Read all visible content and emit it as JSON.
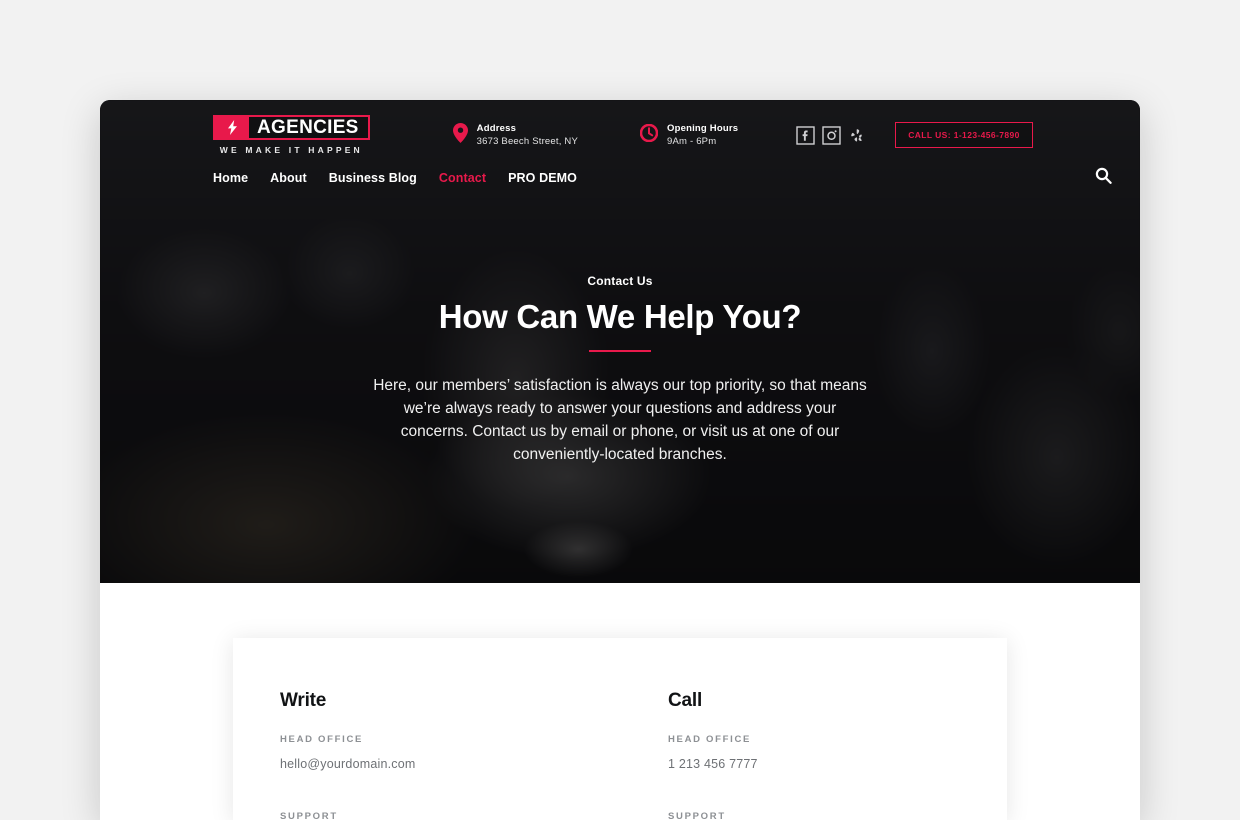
{
  "brand": {
    "name": "AGENCIES",
    "tagline": "WE MAKE IT HAPPEN",
    "logo_icon": "lightning-bolt-icon",
    "accent_color": "#e8194b"
  },
  "topbar": {
    "address": {
      "icon": "map-pin-icon",
      "label": "Address",
      "value": "3673 Beech Street, NY"
    },
    "hours": {
      "icon": "clock-icon",
      "label": "Opening Hours",
      "value": "9Am - 6Pm"
    },
    "socials": [
      {
        "name": "facebook-icon",
        "label": "Facebook"
      },
      {
        "name": "instagram-icon",
        "label": "Instagram"
      },
      {
        "name": "yelp-icon",
        "label": "Yelp"
      }
    ],
    "cta_label": "CALL US: 1-123-456-7890"
  },
  "nav": {
    "items": [
      {
        "label": "Home",
        "active": false
      },
      {
        "label": "About",
        "active": false
      },
      {
        "label": "Business Blog",
        "active": false
      },
      {
        "label": "Contact",
        "active": true
      },
      {
        "label": "PRO DEMO",
        "active": false
      }
    ],
    "search_icon": "search-icon"
  },
  "hero": {
    "eyebrow": "Contact Us",
    "headline": "How Can We Help You?",
    "paragraph": "Here, our members’ satisfaction is always our top priority, so that means we’re always ready to answer your questions and address your concerns. Contact us by email or phone, or visit us at one of our conveniently-located branches."
  },
  "contact_card": {
    "write": {
      "title": "Write",
      "head_office_label": "HEAD OFFICE",
      "head_office_value": "hello@yourdomain.com",
      "support_label": "SUPPORT"
    },
    "call": {
      "title": "Call",
      "head_office_label": "HEAD OFFICE",
      "head_office_value": "1 213 456 7777",
      "support_label": "SUPPORT"
    }
  }
}
